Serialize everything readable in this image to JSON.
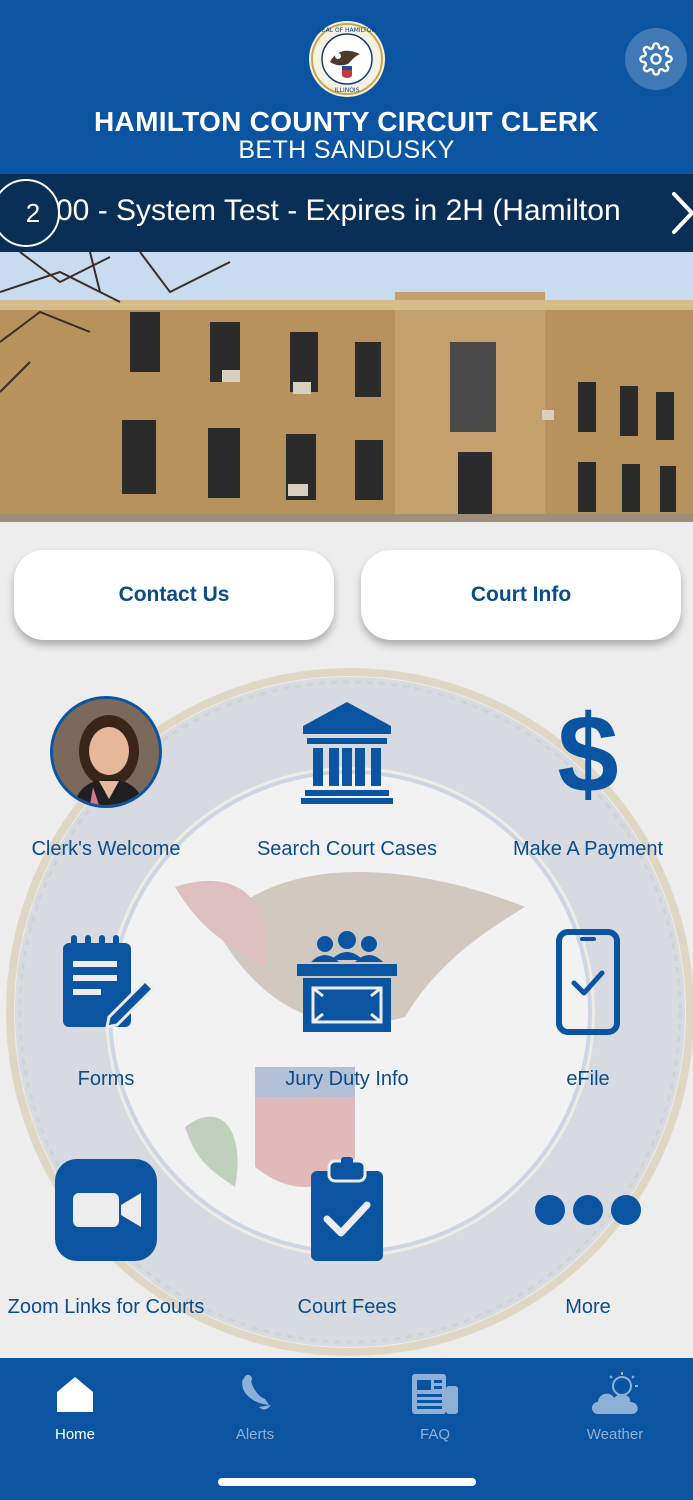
{
  "header": {
    "title": "HAMILTON COUNTY CIRCUIT CLERK",
    "subtitle": "BETH SANDUSKY",
    "seal_text": "SEAL OF HAMILTON COUNTY, ILLINOIS"
  },
  "ticker": {
    "count": "2",
    "text": "00 - System Test - Expires in 2H (Hamilton"
  },
  "buttons": {
    "contact": "Contact Us",
    "court_info": "Court Info"
  },
  "tiles": [
    {
      "label": "Clerk's Welcome",
      "icon": "clerk-photo"
    },
    {
      "label": "Search Court Cases",
      "icon": "courthouse-icon"
    },
    {
      "label": "Make A Payment",
      "icon": "dollar-icon"
    },
    {
      "label": "Forms",
      "icon": "form-edit-icon"
    },
    {
      "label": "Jury Duty Info",
      "icon": "jury-box-icon"
    },
    {
      "label": "eFile",
      "icon": "phone-check-icon"
    },
    {
      "label": "Zoom Links for Courts",
      "icon": "video-camera-icon"
    },
    {
      "label": "Court Fees",
      "icon": "clipboard-check-icon"
    },
    {
      "label": "More",
      "icon": "more-dots-icon"
    }
  ],
  "tabbar": {
    "items": [
      {
        "label": "Home",
        "icon": "home-icon",
        "active": true
      },
      {
        "label": "Alerts",
        "icon": "bell-icon",
        "active": false
      },
      {
        "label": "FAQ",
        "icon": "newspaper-icon",
        "active": false
      },
      {
        "label": "Weather",
        "icon": "cloud-sun-icon",
        "active": false
      }
    ]
  },
  "colors": {
    "primary": "#0b54a2",
    "ticker_bg": "#0a2f57",
    "text_blue": "#0b4c8c",
    "background": "#ededed"
  }
}
